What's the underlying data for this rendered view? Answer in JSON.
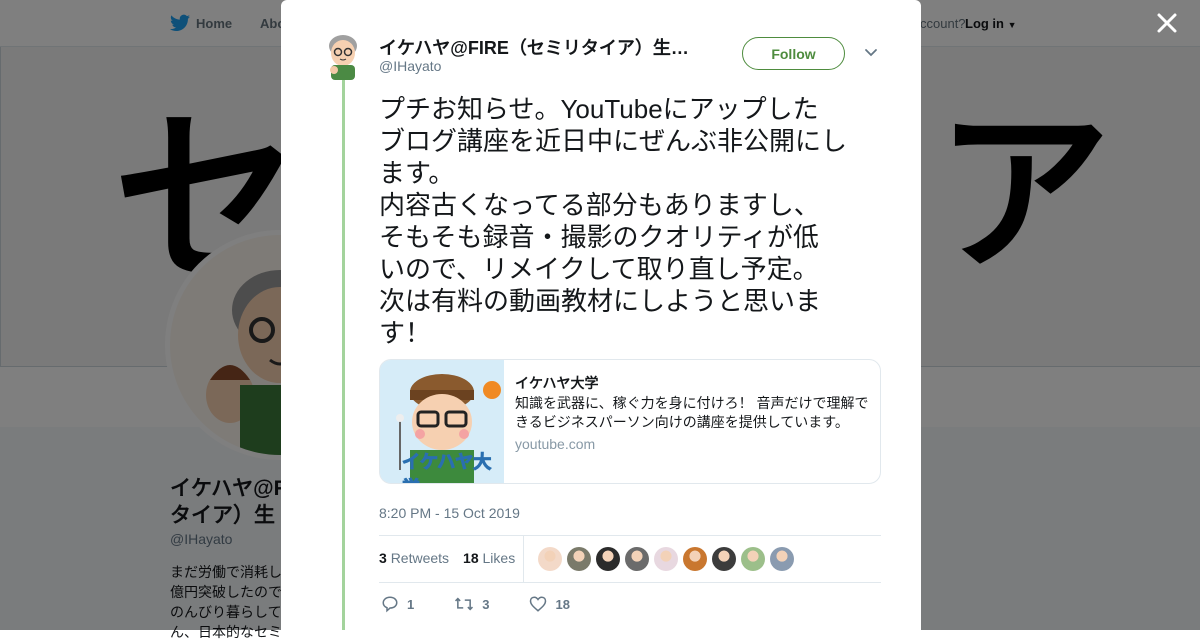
{
  "background": {
    "nav": {
      "home_label": "Home",
      "about_label": "Abo",
      "account_label": "ccount?",
      "login_label": "Log in"
    },
    "banner": {
      "left_char": "セ",
      "right_char": "ア"
    },
    "profile": {
      "name": "イケハヤ@F\nタイア）生",
      "handle": "@IHayato",
      "bio": "まだ労働で消耗し\n億円突破したので\nのんびり暮らして\nん、日本的なセミ"
    }
  },
  "modal": {
    "author": {
      "name": "イケハヤ@FIRE（セミリタイア）生…",
      "handle": "@IHayato"
    },
    "follow_label": "Follow",
    "tweet_lines": [
      "プチお知らせ。YouTubeにアップした",
      "ブログ講座を近日中にぜんぶ非公開にし",
      "ます。",
      "内容古くなってる部分もありますし、",
      "そもそも録音・撮影のクオリティが低",
      "いので、リメイクして取り直し予定。",
      "次は有料の動画教材にしようと思いま",
      "す！"
    ],
    "card": {
      "image_caption": "イケハヤ大学",
      "title": "イケハヤ大学",
      "description": "知識を武器に、稼ぐ力を身に付けろ！ 音声だけで理解できるビジネスパーソン向けの講座を提供しています。",
      "domain": "youtube.com"
    },
    "timestamp": "8:20 PM - 15 Oct 2019",
    "stats": {
      "retweets_count": "3",
      "retweets_label": "Retweets",
      "likes_count": "18",
      "likes_label": "Likes"
    },
    "liker_colors": [
      "#f3d9c8",
      "#7a7a6a",
      "#2b2b2b",
      "#6b6b6b",
      "#e8d8e0",
      "#c9772f",
      "#3c3c3c",
      "#9cbf8a",
      "#8a9bb0"
    ],
    "actions": {
      "reply_count": "1",
      "retweet_count": "3",
      "like_count": "18"
    }
  },
  "colors": {
    "accent_green": "#4e8c3e",
    "thread_line": "#a3d39c",
    "twitter_blue": "#1da1f2"
  }
}
